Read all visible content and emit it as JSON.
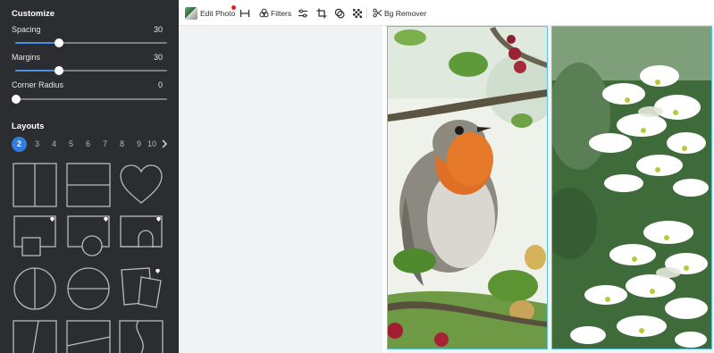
{
  "sidebar": {
    "customize_title": "Customize",
    "sliders": [
      {
        "label": "Spacing",
        "value": "30",
        "fraction": 0.29
      },
      {
        "label": "Margins",
        "value": "30",
        "fraction": 0.29
      },
      {
        "label": "Corner Radius",
        "value": "0",
        "fraction": 0.0
      }
    ],
    "layouts_title": "Layouts",
    "pages": [
      "2",
      "3",
      "4",
      "5",
      "6",
      "7",
      "8",
      "9",
      "10"
    ],
    "active_page": "2",
    "layouts": [
      {
        "name": "layout-two-columns",
        "premium": false
      },
      {
        "name": "layout-two-rows",
        "premium": false
      },
      {
        "name": "layout-heart",
        "premium": false
      },
      {
        "name": "layout-square-inset",
        "premium": true
      },
      {
        "name": "layout-circle-inset",
        "premium": true
      },
      {
        "name": "layout-arch-inset",
        "premium": true
      },
      {
        "name": "layout-circle-vertical-split",
        "premium": false
      },
      {
        "name": "layout-circle-horizontal-split",
        "premium": false
      },
      {
        "name": "layout-tilted-cards",
        "premium": true
      },
      {
        "name": "layout-diagonal-columns",
        "premium": false
      },
      {
        "name": "layout-diagonal-rows",
        "premium": false
      },
      {
        "name": "layout-wave-columns",
        "premium": false
      }
    ]
  },
  "toolbar": {
    "edit_photo_label": "Edit Photo",
    "filters_label": "Filters",
    "bg_remover_label": "Bg Remover",
    "icons": [
      "image-thumbnail-icon",
      "width-resize-icon",
      "filters-icon",
      "adjust-icon",
      "crop-icon",
      "overlay-icon",
      "transparency-icon",
      "scissors-icon"
    ]
  },
  "canvas": {
    "photos": [
      "robin-bird-photo",
      "white-flowers-photo"
    ]
  },
  "colors": {
    "sidebar_bg": "#2b2d31",
    "accent_blue": "#2f7de1",
    "selection_border": "#55c4e6"
  }
}
